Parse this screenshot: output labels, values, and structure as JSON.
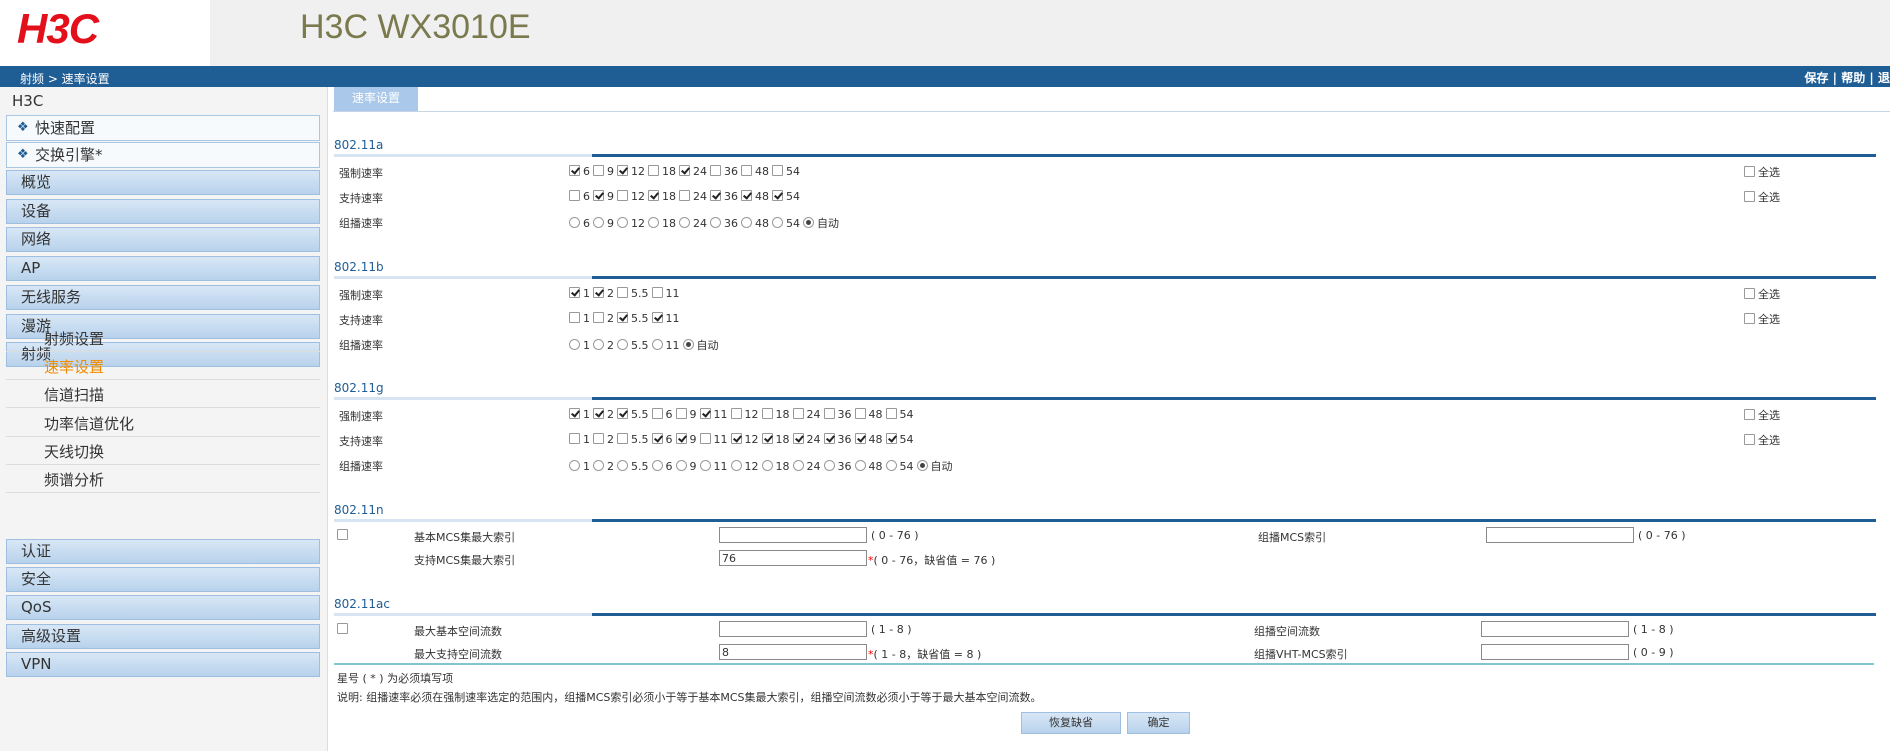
{
  "header": {
    "logo": "H3C",
    "product": "H3C WX3010E"
  },
  "navbar": {
    "breadcrumb": "射频 > 速率设置",
    "save": "保存",
    "help": "帮助",
    "extra": "退"
  },
  "sidebar": {
    "root": "H3C",
    "quick": [
      {
        "label": "快速配置"
      },
      {
        "label": "交换引擎*"
      }
    ],
    "menus_top": [
      {
        "label": "概览"
      },
      {
        "label": "设备"
      },
      {
        "label": "网络"
      },
      {
        "label": "AP"
      },
      {
        "label": "无线服务"
      },
      {
        "label": "漫游"
      },
      {
        "label": "射频"
      }
    ],
    "subs": [
      {
        "label": "射频设置"
      },
      {
        "label": "速率设置"
      },
      {
        "label": "信道扫描"
      },
      {
        "label": "功率信道优化"
      },
      {
        "label": "天线切换"
      },
      {
        "label": "频谱分析"
      }
    ],
    "menus_bottom": [
      {
        "label": "认证"
      },
      {
        "label": "安全"
      },
      {
        "label": "QoS"
      },
      {
        "label": "高级设置"
      },
      {
        "label": "VPN"
      }
    ]
  },
  "tab": "速率设置",
  "labels": {
    "mandatory": "强制速率",
    "supported": "支持速率",
    "multicast": "组播速率",
    "select_all": "全选",
    "auto": "自动"
  },
  "sections": [
    {
      "title": "802.11a",
      "mandatory": [
        {
          "v": "6",
          "c": true
        },
        {
          "v": "9",
          "c": false
        },
        {
          "v": "12",
          "c": true
        },
        {
          "v": "18",
          "c": false
        },
        {
          "v": "24",
          "c": true
        },
        {
          "v": "36",
          "c": false
        },
        {
          "v": "48",
          "c": false
        },
        {
          "v": "54",
          "c": false
        }
      ],
      "supported": [
        {
          "v": "6",
          "c": false
        },
        {
          "v": "9",
          "c": true
        },
        {
          "v": "12",
          "c": false
        },
        {
          "v": "18",
          "c": true
        },
        {
          "v": "24",
          "c": false
        },
        {
          "v": "36",
          "c": true
        },
        {
          "v": "48",
          "c": true
        },
        {
          "v": "54",
          "c": true
        }
      ],
      "multicast": [
        "6",
        "9",
        "12",
        "18",
        "24",
        "36",
        "48",
        "54"
      ]
    },
    {
      "title": "802.11b",
      "mandatory": [
        {
          "v": "1",
          "c": true
        },
        {
          "v": "2",
          "c": true
        },
        {
          "v": "5.5",
          "c": false
        },
        {
          "v": "11",
          "c": false
        }
      ],
      "supported": [
        {
          "v": "1",
          "c": false
        },
        {
          "v": "2",
          "c": false
        },
        {
          "v": "5.5",
          "c": true
        },
        {
          "v": "11",
          "c": true
        }
      ],
      "multicast": [
        "1",
        "2",
        "5.5",
        "11"
      ]
    },
    {
      "title": "802.11g",
      "mandatory": [
        {
          "v": "1",
          "c": true
        },
        {
          "v": "2",
          "c": true
        },
        {
          "v": "5.5",
          "c": true
        },
        {
          "v": "6",
          "c": false
        },
        {
          "v": "9",
          "c": false
        },
        {
          "v": "11",
          "c": true
        },
        {
          "v": "12",
          "c": false
        },
        {
          "v": "18",
          "c": false
        },
        {
          "v": "24",
          "c": false
        },
        {
          "v": "36",
          "c": false
        },
        {
          "v": "48",
          "c": false
        },
        {
          "v": "54",
          "c": false
        }
      ],
      "supported": [
        {
          "v": "1",
          "c": false
        },
        {
          "v": "2",
          "c": false
        },
        {
          "v": "5.5",
          "c": false
        },
        {
          "v": "6",
          "c": true
        },
        {
          "v": "9",
          "c": true
        },
        {
          "v": "11",
          "c": false
        },
        {
          "v": "12",
          "c": true
        },
        {
          "v": "18",
          "c": true
        },
        {
          "v": "24",
          "c": true
        },
        {
          "v": "36",
          "c": true
        },
        {
          "v": "48",
          "c": true
        },
        {
          "v": "54",
          "c": true
        }
      ],
      "multicast": [
        "1",
        "2",
        "5.5",
        "6",
        "9",
        "11",
        "12",
        "18",
        "24",
        "36",
        "48",
        "54"
      ]
    }
  ],
  "n": {
    "title": "802.11n",
    "basic_label": "基本MCS集最大索引",
    "basic_value": "",
    "basic_hint": "( 0 - 76 )",
    "support_label": "支持MCS集最大索引",
    "support_value": "76",
    "support_hint": "( 0 - 76，缺省值 = 76 )",
    "mc_label": "组播MCS索引",
    "mc_value": "",
    "mc_hint": "( 0 - 76 )"
  },
  "ac": {
    "title": "802.11ac",
    "basic_label": "最大基本空间流数",
    "basic_value": "",
    "basic_hint": "( 1 - 8 )",
    "support_label": "最大支持空间流数",
    "support_value": "8",
    "support_hint": "( 1 - 8，缺省值 = 8 )",
    "mc_label": "组播空间流数",
    "mc_value": "",
    "mc_hint": "( 1 - 8 )",
    "vht_label": "组播VHT-MCS索引",
    "vht_value": "",
    "vht_hint": "( 0 - 9 )"
  },
  "notes": {
    "required": "星号 ( * ) 为必须填写项",
    "desc": "说明: 组播速率必须在强制速率选定的范围内，组播MCS索引必须小于等于基本MCS集最大索引，组播空间流数必须小于等于最大基本空间流数。"
  },
  "buttons": {
    "restore": "恢复缺省",
    "ok": "确定"
  }
}
